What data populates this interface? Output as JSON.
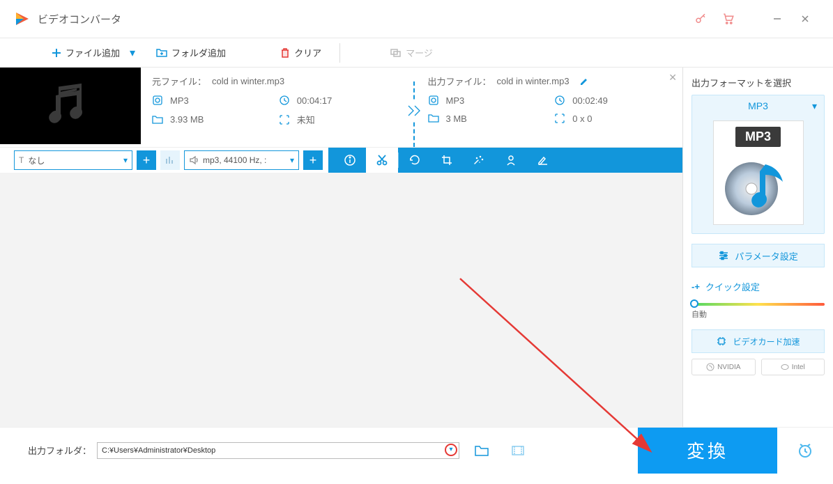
{
  "window": {
    "title": "ビデオコンバータ"
  },
  "toolbar": {
    "add_file": "ファイル追加",
    "add_folder": "フォルダ追加",
    "clear": "クリア",
    "merge": "マージ"
  },
  "file": {
    "source_label": "元ファイル：",
    "source_name": "cold in winter.mp3",
    "output_label": "出力ファイル：",
    "output_name": "cold in winter.mp3",
    "src_format": "MP3",
    "src_duration": "00:04:17",
    "src_size": "3.93 MB",
    "src_dimensions": "未知",
    "out_format": "MP3",
    "out_duration": "00:02:49",
    "out_size": "3 MB",
    "out_dimensions": "0 x 0"
  },
  "editbar": {
    "subtitle_none": "なし",
    "audio_info": "mp3, 44100 Hz, :"
  },
  "sidebar": {
    "header": "出力フォーマットを選択",
    "format": "MP3",
    "param_settings": "パラメータ設定",
    "quick_settings": "クイック設定",
    "slider_label": "自動",
    "gpu_accel": "ビデオカード加速",
    "nvidia": "NVIDIA",
    "intel": "Intel"
  },
  "bottom": {
    "output_folder_label": "出力フォルダ：",
    "output_path": "C:¥Users¥Administrator¥Desktop",
    "convert": "変換"
  }
}
